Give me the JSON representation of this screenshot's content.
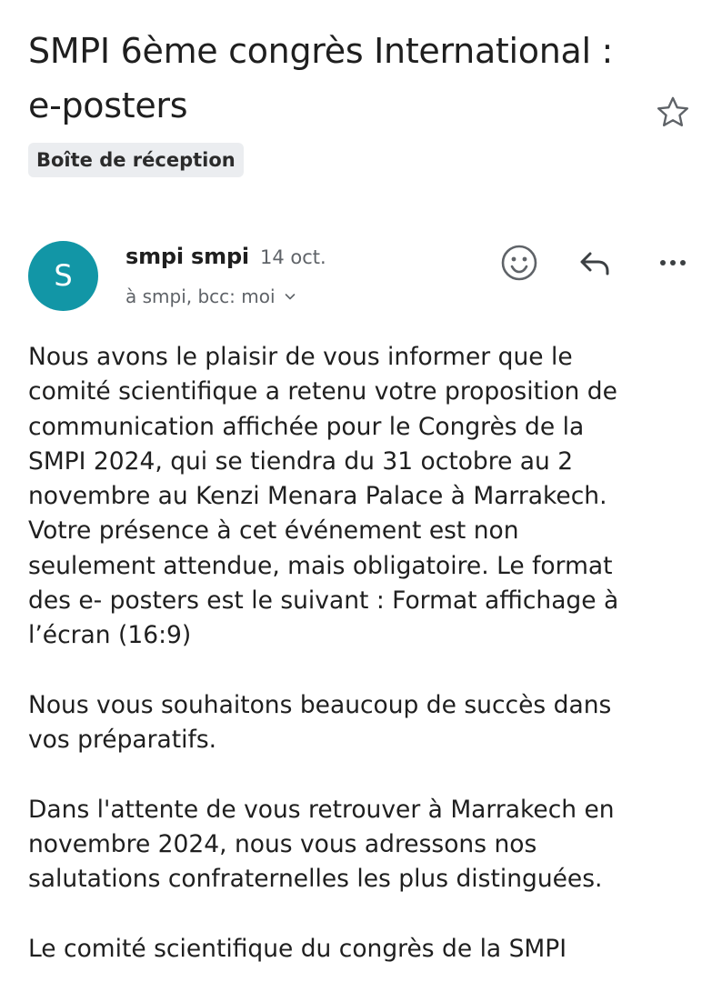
{
  "subject": "SMPI 6ème congrès International : e-posters",
  "label": "Boîte de réception",
  "message": {
    "avatar_letter": "S",
    "sender": "smpi smpi",
    "date": "14 oct.",
    "recipients": "à smpi, bcc: moi",
    "paragraphs": [
      "Nous avons le plaisir de vous informer que le\ncomité scientifique a retenu votre proposition de\ncommunication affichée pour le Congrès de la\nSMPI 2024, qui se tiendra du 31 octobre au 2\nnovembre au Kenzi Menara Palace à Marrakech.\nVotre présence à cet événement est non\nseulement attendue, mais obligatoire. Le format\ndes e- posters est le suivant : Format affichage à\nl’écran (16:9)",
      "Nous vous souhaitons beaucoup de succès dans\nvos préparatifs.",
      "Dans l'attente de vous retrouver à Marrakech en\nnovembre 2024, nous vous adressons nos\nsalutations confraternelles les plus distinguées.",
      "Le comité scientifique du congrès de la SMPI"
    ]
  },
  "icons": {
    "star": "star-outline-icon",
    "emoji": "smiley-icon",
    "reply": "reply-icon",
    "more": "more-horizontal-icon",
    "chevron": "chevron-down-icon"
  },
  "colors": {
    "avatar_bg": "#1296a6",
    "label_chip_bg": "#ebedf0",
    "secondary_text": "#5f6368"
  }
}
